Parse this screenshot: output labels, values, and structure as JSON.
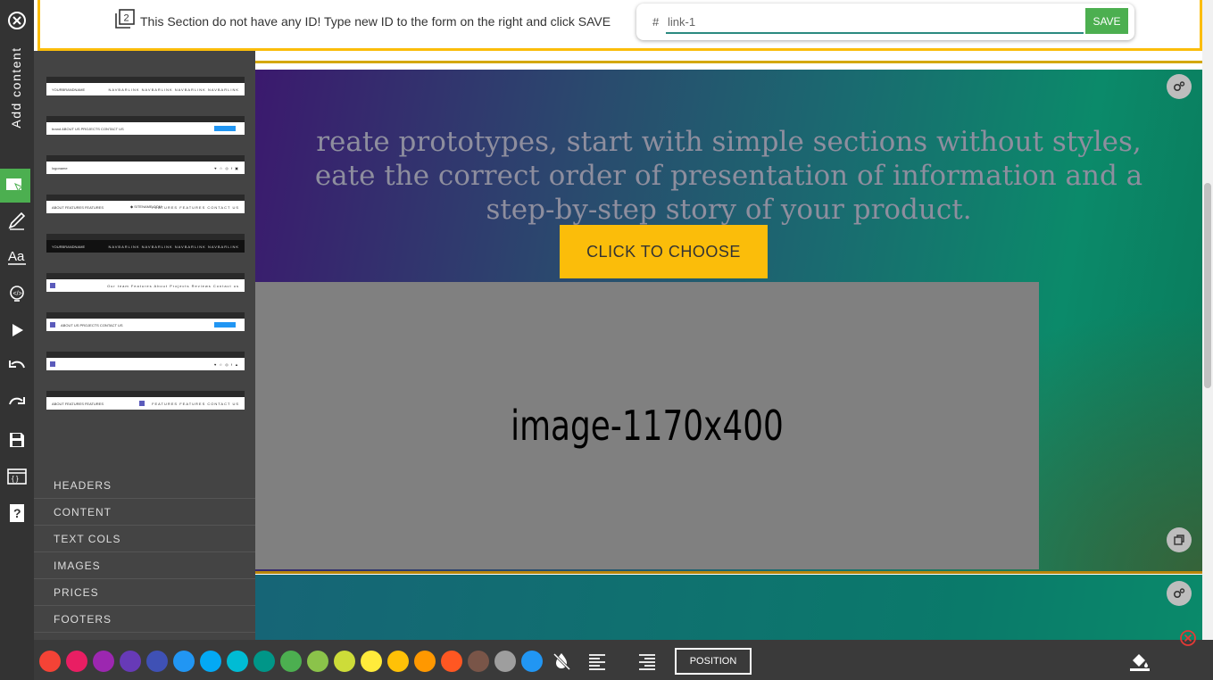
{
  "id_bar": {
    "message": "This Section do not have any ID! Type new ID to the form on the right and click SAVE",
    "hash": "#",
    "input_value": "link-1",
    "save_label": "SAVE"
  },
  "sidebar": {
    "add_content_label": "Add content"
  },
  "thumbnails": [
    {
      "left": "YOURBRANDNAME",
      "right": "NAVBARLINK NAVBARLINK NAVBARLINK NAVBARLINK"
    },
    {
      "left": "brand  ABOUT US  PROJECTS  CONTACT US",
      "right": ""
    },
    {
      "left": "logoname",
      "right": "♥ ☆ ◎ f ▣"
    },
    {
      "left": "ABOUT  FEATURES  FEATURES",
      "center": "◆ SITENAME.COM",
      "right": "FEATURES  FEATURES  CONTACT US"
    },
    {
      "left": "YOURBRANDNAME",
      "right": "NAVBARLINK  NAVBARLINK  NAVBARLINK  NAVBARLINK"
    },
    {
      "left": "",
      "right": "Our team  Features  About  Projects  Reviews  Contact us"
    },
    {
      "left": "ABOUT US  PROJECTS  CONTACT US",
      "right": ""
    },
    {
      "left": "",
      "right": "♥ ☆ ◎ f ▲"
    },
    {
      "left": "ABOUT  FEATURES  FEATURES",
      "center": "",
      "right": "FEATURES  FEATURES  CONTACT US"
    }
  ],
  "categories": [
    "HEADERS",
    "CONTENT",
    "TEXT COLS",
    "IMAGES",
    "PRICES",
    "FOOTERS"
  ],
  "hero": {
    "line1": "reate prototypes, start with simple sections without styles,",
    "line2": "eate the correct order of presentation of information and a",
    "line3": "step-by-step story of your product.",
    "cta_label": "CLICK TO CHOOSE",
    "image_label": "image-1170x400"
  },
  "bottom_bar": {
    "colors": [
      "#f44336",
      "#e91e63",
      "#9c27b0",
      "#673ab7",
      "#3f51b5",
      "#2196f3",
      "#03a9f4",
      "#00bcd4",
      "#009688",
      "#4caf50",
      "#8bc34a",
      "#cddc39",
      "#ffeb3b",
      "#ffc107",
      "#ff9800",
      "#ff5722",
      "#795548",
      "#9e9e9e",
      "#2196f3"
    ],
    "position_label": "POSITION"
  }
}
